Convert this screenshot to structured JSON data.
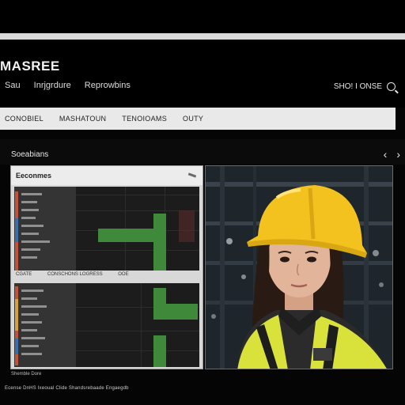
{
  "app": {
    "brand": "MASREE"
  },
  "top_links": [
    "Sau",
    "Inrjgrdure",
    "Reprowbins"
  ],
  "header_right": {
    "label": "SHO! I ONSE"
  },
  "nav": [
    "CONOBIEL",
    "MASHATOUN",
    "TENOIOAMS",
    "OUTY"
  ],
  "section": {
    "title": "Soeabians",
    "prev": "‹",
    "next": "›"
  },
  "panel": {
    "title": "Eeconmes",
    "mid_caption": [
      "CGATE",
      "CONSCHONS LOGRESS",
      "OOE"
    ]
  },
  "panel_caption": "Shemble Dore",
  "footer": "Ecense DnHS Ixeoual Clide Shandsrebaade Engaegdb",
  "colors": {
    "accent_green": "#3f8a3a",
    "helmet_yellow": "#f4c21f",
    "vest_yellow": "#d8e23a"
  },
  "icons": [
    "search-icon",
    "chevron-left-icon",
    "chevron-right-icon",
    "edit-icon"
  ]
}
